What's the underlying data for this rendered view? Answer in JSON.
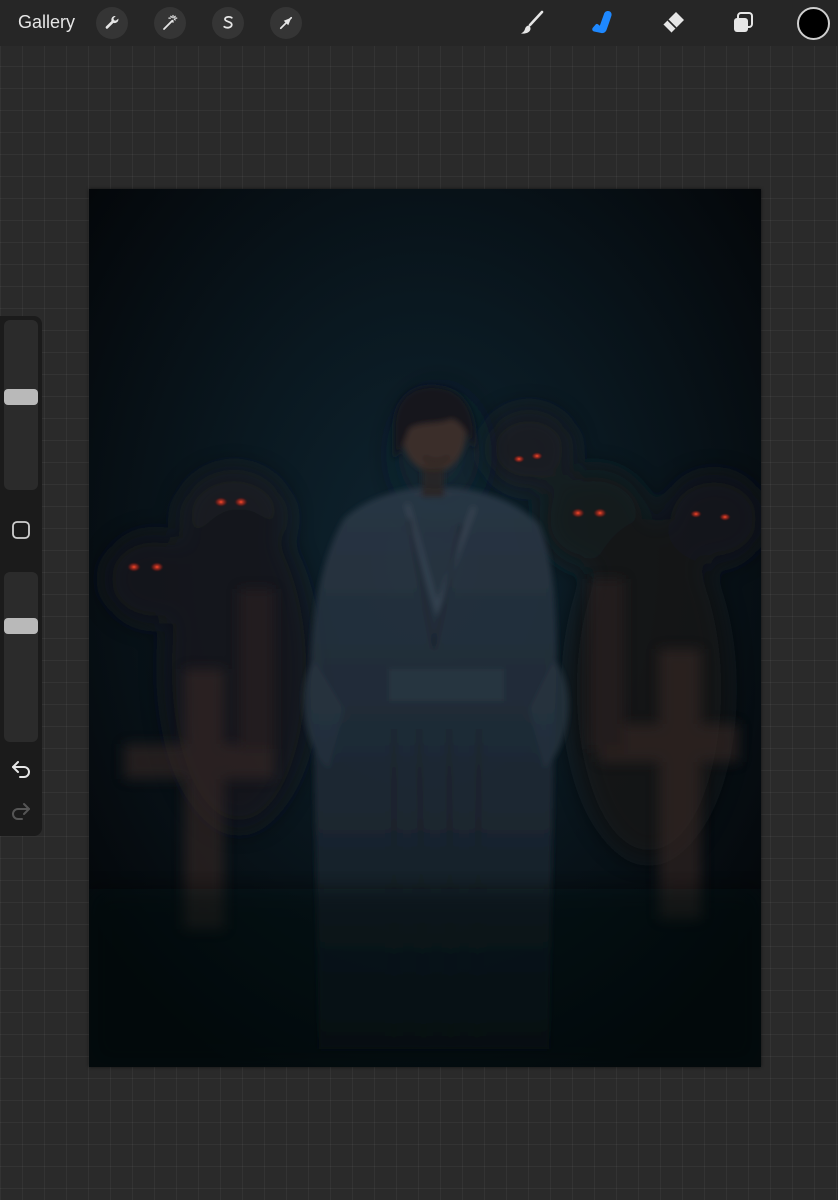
{
  "toolbar": {
    "gallery_label": "Gallery",
    "actions_icon": "wrench-icon",
    "adjustments_icon": "magic-wand-icon",
    "selection_icon": "selection-s-icon",
    "transform_icon": "arrow-cursor-icon",
    "brush_icon": "paintbrush-icon",
    "smudge_icon": "smudge-finger-icon",
    "eraser_icon": "eraser-icon",
    "layers_icon": "layers-icon",
    "active_tool": "smudge",
    "active_color": "#1e88ff",
    "icon_color": "#e6e6e6",
    "current_color": "#000000"
  },
  "sidebar": {
    "brush_size_level": 0.55,
    "opacity_level": 0.7,
    "modify_icon": "square-icon",
    "undo_icon": "undo-icon",
    "redo_icon": "redo-icon",
    "redo_enabled": false
  },
  "canvas": {
    "background_color": "#070b10",
    "description_icon": "artwork-image"
  }
}
